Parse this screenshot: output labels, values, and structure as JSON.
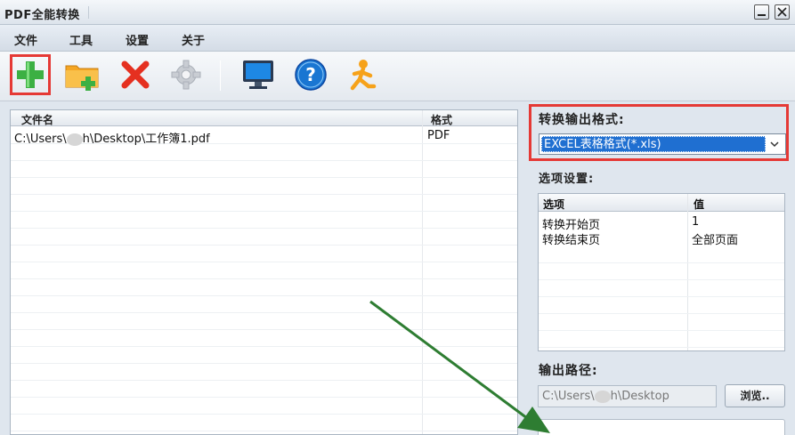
{
  "window": {
    "title": "PDF全能转换",
    "minimize_icon": "minimize-icon",
    "close_icon": "close-icon"
  },
  "menu": {
    "items": [
      {
        "label": "文件"
      },
      {
        "label": "工具"
      },
      {
        "label": "设置"
      },
      {
        "label": "关于"
      }
    ]
  },
  "toolbar": {
    "buttons": [
      {
        "icon": "add-file-icon",
        "highlighted": true
      },
      {
        "icon": "add-folder-icon",
        "highlighted": false
      },
      {
        "icon": "delete-icon",
        "highlighted": false
      },
      {
        "icon": "settings-gear-icon",
        "highlighted": false
      },
      {
        "icon": "monitor-icon",
        "highlighted": false
      },
      {
        "icon": "help-icon",
        "highlighted": false
      },
      {
        "icon": "run-person-icon",
        "highlighted": false
      }
    ]
  },
  "file_list": {
    "columns": [
      "文件名",
      "格式"
    ],
    "rows": [
      {
        "path_prefix": "C:\\Users\\",
        "path_suffix": "h\\Desktop\\工作簿1.pdf",
        "format": "PDF"
      }
    ]
  },
  "output_format": {
    "label": "转换输出格式:",
    "selected": "EXCEL表格格式(*.xls)"
  },
  "options": {
    "label": "选项设置:",
    "columns": [
      "选项",
      "值"
    ],
    "rows": [
      {
        "option": "转换开始页",
        "value": "1"
      },
      {
        "option": "转换结束页",
        "value": "全部页面"
      }
    ]
  },
  "output_path": {
    "label": "输出路径:",
    "value_prefix": "C:\\Users\\",
    "value_suffix": "h\\Desktop",
    "browse_label": "浏览.."
  },
  "colors": {
    "highlight_border": "#e53935",
    "arrow": "#2e7d32",
    "selection": "#1f6fd1"
  }
}
